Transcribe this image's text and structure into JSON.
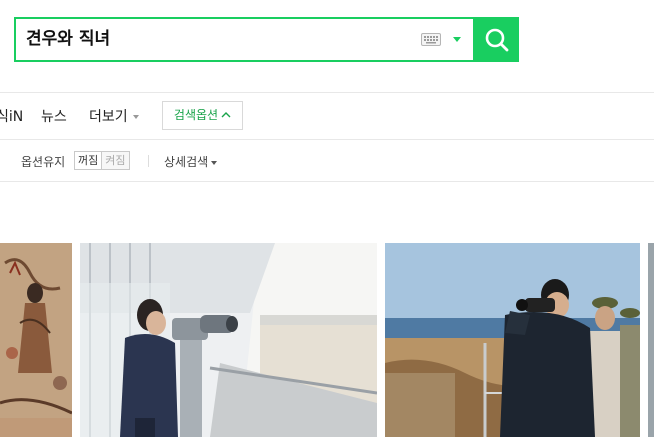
{
  "search": {
    "query": "견우와 직녀",
    "keyboard_icon": "keyboard-icon",
    "dropdown_icon": "triangle-down-icon",
    "search_icon": "magnifier-icon"
  },
  "tabs": {
    "partial_tab": "식iN",
    "news": "뉴스",
    "more": "더보기",
    "search_options": "검색옵션"
  },
  "options": {
    "keep_label": "옵션유지",
    "toggle_off": "꺼짐",
    "toggle_on": "켜짐",
    "detail_search": "상세검색"
  },
  "images": [
    {
      "name": "mural-painting",
      "alt": "ancient mural painting"
    },
    {
      "name": "woman-binoculars",
      "alt": "woman using coin binoculars on observation deck"
    },
    {
      "name": "man-binoculars",
      "alt": "man in dark coat looking through binoculars with officers"
    }
  ],
  "colors": {
    "brand": "#19ce60",
    "option_text": "#19a34a"
  }
}
